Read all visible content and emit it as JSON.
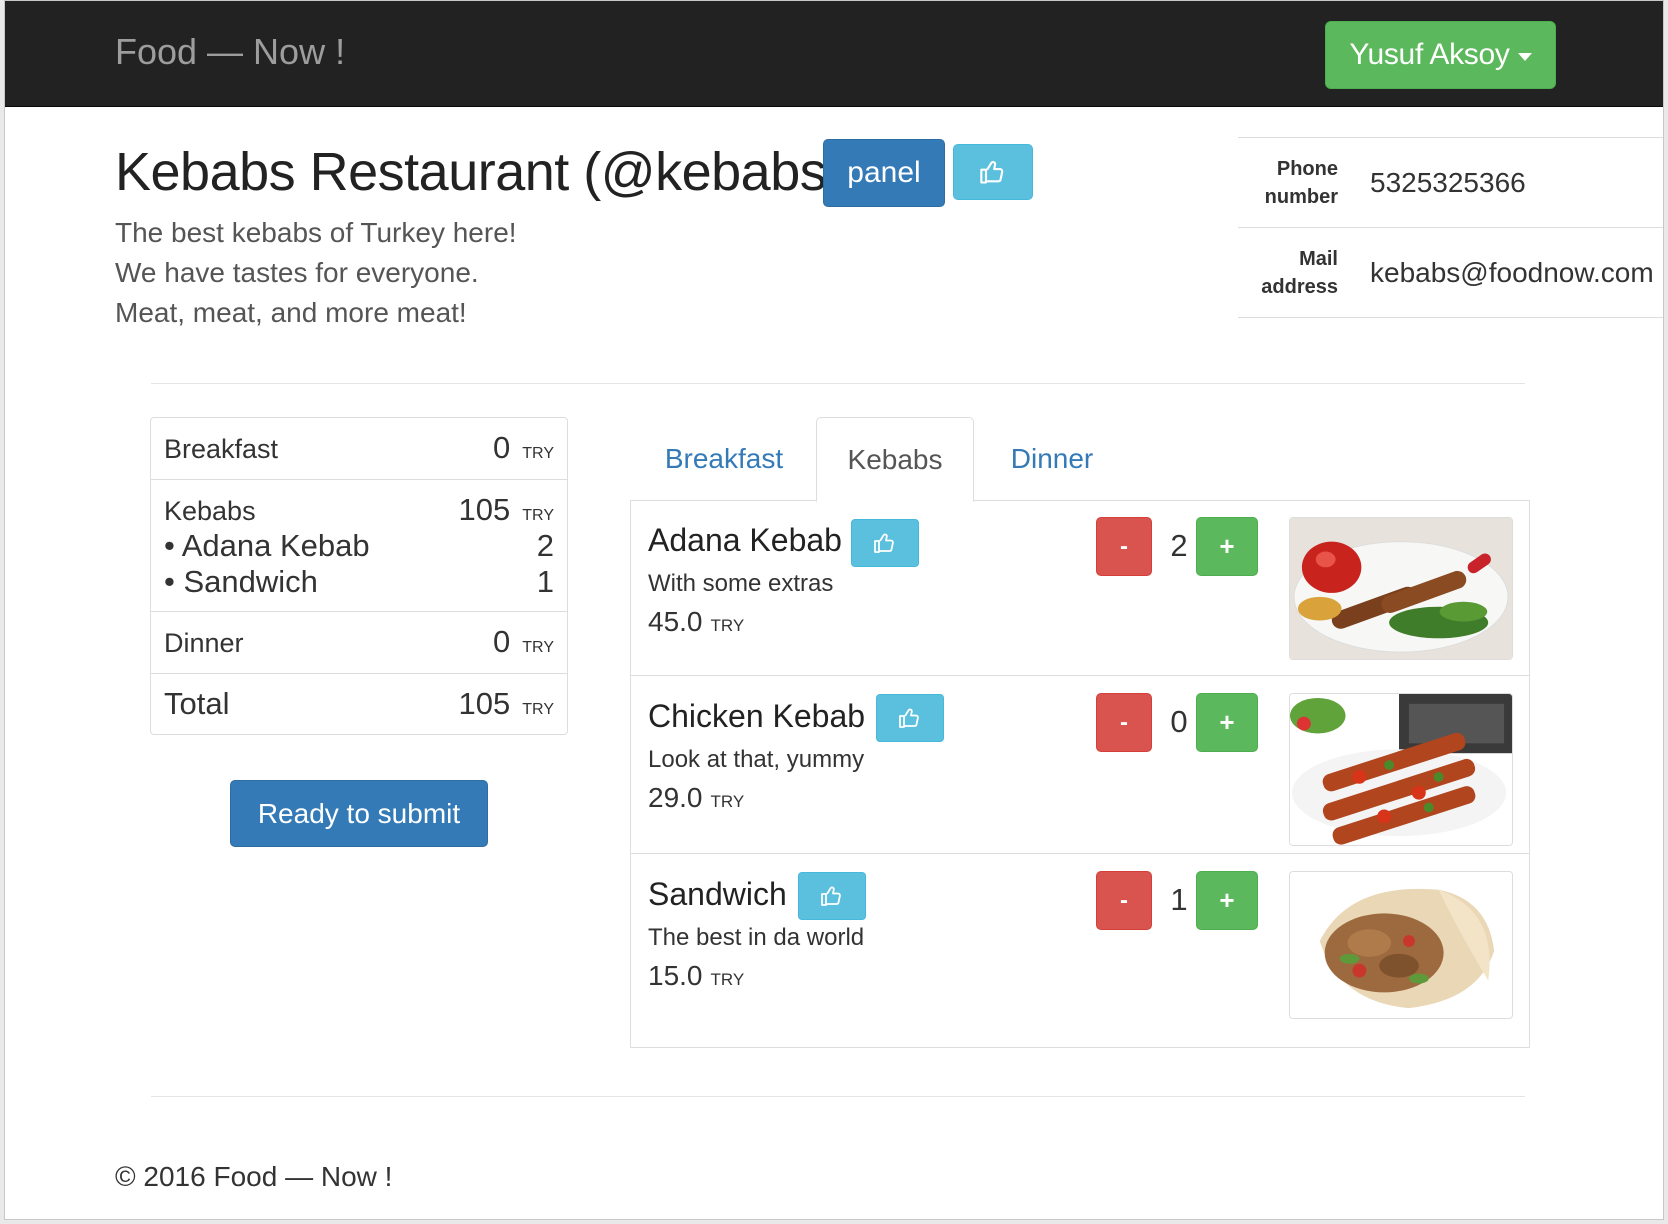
{
  "navbar": {
    "brand": "Food — Now !",
    "user_name": "Yusuf Aksoy"
  },
  "restaurant": {
    "title": "Kebabs Restaurant (@kebabs)",
    "panel_label": "panel",
    "description_lines": [
      "The best kebabs of Turkey here!",
      "We have tastes for everyone.",
      "Meat, meat, and more meat!"
    ]
  },
  "contact": {
    "phone_label_1": "Phone",
    "phone_label_2": "number",
    "phone_value": "5325325366",
    "mail_label_1": "Mail",
    "mail_label_2": "address",
    "mail_value": "kebabs@foodnow.com"
  },
  "summary": {
    "currency": "TRY",
    "rows": [
      {
        "category": "Breakfast",
        "amount": "0"
      },
      {
        "category": "Kebabs",
        "amount": "105",
        "items": [
          {
            "name": "• Adana Kebab",
            "qty": "2"
          },
          {
            "name": "• Sandwich",
            "qty": "1"
          }
        ]
      },
      {
        "category": "Dinner",
        "amount": "0"
      },
      {
        "category": "Total",
        "amount": "105"
      }
    ]
  },
  "submit_label": "Ready to submit",
  "tabs": [
    {
      "label": "Breakfast",
      "active": false
    },
    {
      "label": "Kebabs",
      "active": true
    },
    {
      "label": "Dinner",
      "active": false
    }
  ],
  "menu": {
    "currency": "TRY",
    "minus_label": "-",
    "plus_label": "+",
    "items": [
      {
        "name": "Adana Kebab",
        "description": "With some extras",
        "price": "45.0",
        "quantity": "2",
        "image": "adana-kebab-photo"
      },
      {
        "name": "Chicken Kebab",
        "description": "Look at that, yummy",
        "price": "29.0",
        "quantity": "0",
        "image": "chicken-kebab-photo"
      },
      {
        "name": "Sandwich",
        "description": "The best in da world",
        "price": "15.0",
        "quantity": "1",
        "image": "sandwich-wrap-photo"
      }
    ]
  },
  "footer": "© 2016 Food — Now !",
  "colors": {
    "navbar_bg": "#222222",
    "success": "#5cb85c",
    "primary": "#337ab7",
    "info": "#5bc0de",
    "danger": "#d9534f"
  }
}
